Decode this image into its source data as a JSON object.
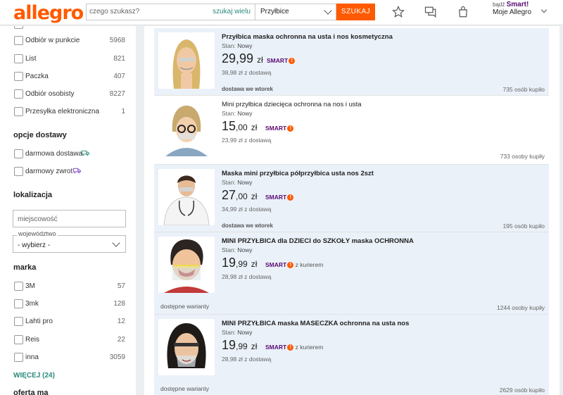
{
  "header": {
    "logo": "allegro",
    "search_placeholder": "czego szukasz?",
    "search_many": "szukaj wielu",
    "category": "Przyłbice",
    "search_button": "SZUKAJ",
    "smart_prefix": "bądź",
    "smart_label": "Smart!",
    "my_allegro": "Moje Allegro"
  },
  "sidebar": {
    "delivery_methods": [
      {
        "label": "Odbiór w punkcie",
        "count": "5968"
      },
      {
        "label": "List",
        "count": "821"
      },
      {
        "label": "Paczka",
        "count": "407"
      },
      {
        "label": "Odbiór osobisty",
        "count": "8227"
      },
      {
        "label": "Przesyłka elektroniczna",
        "count": "1"
      }
    ],
    "delivery_options_title": "opcje dostawy",
    "delivery_options": [
      {
        "label": "darmowa dostawa"
      },
      {
        "label": "darmowy zwrot"
      }
    ],
    "location_title": "lokalizacja",
    "city_placeholder": "miejscowość",
    "region_legend": "województwo",
    "region_value": "- wybierz -",
    "brand_title": "marka",
    "brands": [
      {
        "label": "3M",
        "count": "57"
      },
      {
        "label": "3mk",
        "count": "128"
      },
      {
        "label": "Lahti pro",
        "count": "12"
      },
      {
        "label": "Reis",
        "count": "22"
      },
      {
        "label": "inna",
        "count": "3059"
      }
    ],
    "more_link": "WIĘCEJ (24)",
    "next_title": "oferta ma"
  },
  "listings": [
    {
      "title": "Przyłbica maska ochronna na usta i nos kosmetyczna",
      "condition_label": "Stan:",
      "condition_value": "Nowy",
      "price_main": "29,99",
      "price_currency": "zł",
      "smart": "SMART",
      "shipping": "38,98 zł z dostawą",
      "delivery": "dostawa we wtorek",
      "bought": "735 osób kupiło"
    },
    {
      "title": "Mini przyłbica dziecięca ochronna na nos i usta",
      "condition_label": "Stan:",
      "condition_value": "Nowy",
      "price_main": "15",
      "price_decimal": ",00",
      "price_currency": "zł",
      "smart": "SMART",
      "shipping": "23,99 zł z dostawą",
      "bought": "733 osoby kupiły"
    },
    {
      "title": "Maska mini przyłbica półprzyłbica usta nos 2szt",
      "condition_label": "Stan:",
      "condition_value": "Nowy",
      "price_main": "27",
      "price_decimal": ",00",
      "price_currency": "zł",
      "smart": "SMART",
      "shipping": "34,99 zł z dostawą",
      "delivery": "dostawa we wtorek",
      "bought": "195 osób kupiło"
    },
    {
      "title": "MINI PRZYŁBICA dla DZIECI do SZKOŁY maska OCHRONNA",
      "condition_label": "Stan:",
      "condition_value": "Nowy",
      "price_main": "19",
      "price_decimal": ",99",
      "price_currency": "zł",
      "smart": "SMART",
      "courier": "z kurierem",
      "shipping": "28,98 zł z dostawą",
      "variants": "dostępne warianty",
      "bought": "1244 osoby kupiły"
    },
    {
      "title": "MINI PRZYŁBICA maska MASECZKA ochronna na usta nos",
      "condition_label": "Stan:",
      "condition_value": "Nowy",
      "price_main": "19",
      "price_decimal": ",99",
      "price_currency": "zł",
      "smart": "SMART",
      "courier": "z kurierem",
      "shipping": "28,98 zł z dostawą",
      "variants": "dostępne warianty",
      "bought": "2629 osób kupiło"
    }
  ],
  "colors": {
    "brand": "#ff5a00",
    "smart": "#5a0b73",
    "link": "#2a8b7c",
    "promo_bg": "#eaf1f9"
  }
}
